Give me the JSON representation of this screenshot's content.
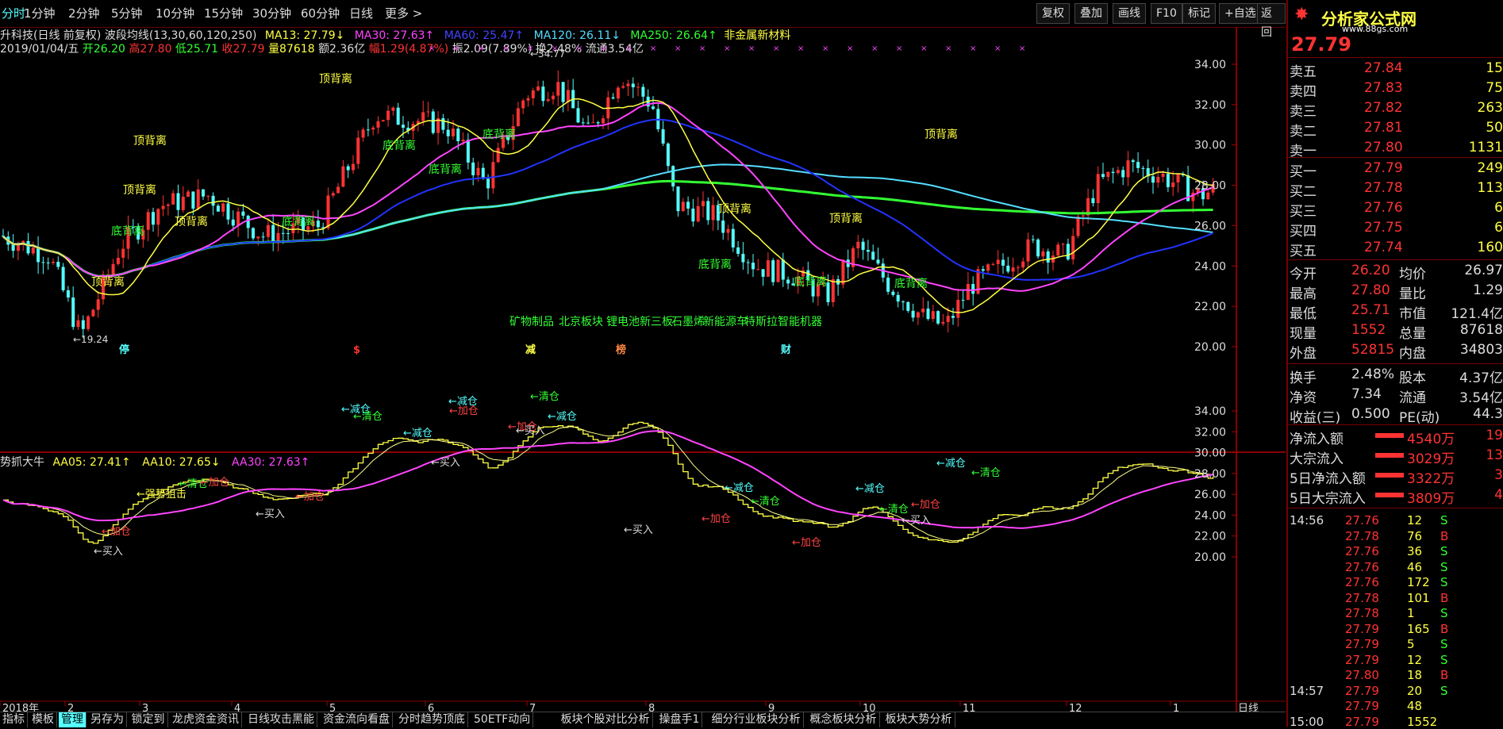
{
  "toolbar": {
    "periods": [
      "分时",
      "1分钟",
      "2分钟",
      "5分钟",
      "10分钟",
      "15分钟",
      "30分钟",
      "60分钟",
      "日线",
      "更多 >"
    ],
    "right_buttons": [
      "复权",
      "叠加",
      "画线",
      "F10",
      "标记",
      "+自选",
      "返回"
    ]
  },
  "info": {
    "stock_line": "升科技(日线 前复权) 波段均线(13,30,60,120,250)",
    "ma13": "MA13: 27.79↓",
    "ma30": "MA30: 27.63↑",
    "ma60": "MA60: 25.47↑",
    "ma120": "MA120: 26.11↓",
    "ma250": "MA250: 26.64↑",
    "sector": "非金属新材料",
    "date": "2019/01/04/五",
    "open": "开26.20",
    "high": "高27.80",
    "low": "低25.71",
    "close": "收27.79",
    "volume": "量87618",
    "amount": "额2.36亿",
    "change": "幅1.29(4.87%)",
    "amplitude": "振2.09(7.89%)",
    "turnover": "换2.48%",
    "float": "流通3.54亿"
  },
  "indicator": {
    "name": "势抓大牛",
    "aa05": "AA05: 27.41↑",
    "aa10": "AA10: 27.65↓",
    "aa30": "AA30: 27.63↑"
  },
  "colors": {
    "ma13": "#ffff44",
    "ma30": "#ff44ff",
    "ma60": "#2233ff",
    "ma120": "#55ddff",
    "ma250": "#33ff33",
    "up": "#ff3333",
    "down": "#55ffff"
  },
  "chart_data": {
    "type": "candlestick",
    "y_ticks_main": [
      "34.00",
      "32.00",
      "30.00",
      "28.00",
      "26.00",
      "24.00",
      "22.00",
      "20.00"
    ],
    "y_ticks_sub": [
      "34.00",
      "32.00",
      "30.00",
      "28.00",
      "26.00",
      "24.00",
      "22.00",
      "20.00"
    ],
    "x_labels": [
      "2018年",
      "2",
      "3",
      "4",
      "5",
      "6",
      "7",
      "8",
      "9",
      "10",
      "11",
      "12",
      "1"
    ],
    "period_label": "日线",
    "max_label": "34.77",
    "min_label": "19.24",
    "annotations_main": [
      "顶背离",
      "顶背离",
      "顶背离",
      "底背离",
      "顶背离",
      "底背离",
      "顶背离",
      "底背离",
      "底背离",
      "底背离",
      "顶背离",
      "底背离",
      "顶背离",
      "底背离",
      "顶背离",
      "底背离"
    ],
    "concepts": [
      "矿物制品",
      "北京板块",
      "锂电池",
      "新三板",
      "石墨烯",
      "新能源车",
      "特斯拉",
      "智能机器"
    ],
    "event_marks": [
      "停",
      "$",
      "减",
      "榜",
      "财"
    ],
    "annotations_sub": [
      "加仓",
      "买入",
      "强势狙击",
      "清仓",
      "加仓",
      "买入",
      "减仓",
      "清仓",
      "加仓",
      "减仓",
      "加仓",
      "买入",
      "减仓",
      "清仓",
      "减仓",
      "加仓",
      "买入",
      "买入",
      "加仓",
      "减仓",
      "清仓",
      "加仓",
      "减仓",
      "清仓",
      "加仓",
      "买入",
      "减仓",
      "清仓"
    ]
  },
  "quote": {
    "logo_main": "分析家公式网",
    "logo_url": "www.88gs.com",
    "last_price": "27.79",
    "asks": [
      {
        "label": "卖五",
        "price": "27.84",
        "vol": "15"
      },
      {
        "label": "卖四",
        "price": "27.83",
        "vol": "75"
      },
      {
        "label": "卖三",
        "price": "27.82",
        "vol": "263"
      },
      {
        "label": "卖二",
        "price": "27.81",
        "vol": "50"
      },
      {
        "label": "卖一",
        "price": "27.80",
        "vol": "1131"
      }
    ],
    "bids": [
      {
        "label": "买一",
        "price": "27.79",
        "vol": "249"
      },
      {
        "label": "买二",
        "price": "27.78",
        "vol": "113"
      },
      {
        "label": "买三",
        "price": "27.76",
        "vol": "6"
      },
      {
        "label": "买四",
        "price": "27.75",
        "vol": "6"
      },
      {
        "label": "买五",
        "price": "27.74",
        "vol": "160"
      }
    ],
    "stats": [
      {
        "k1": "今开",
        "v1": "26.20",
        "k2": "均价",
        "v2": "26.97"
      },
      {
        "k1": "最高",
        "v1": "27.80",
        "k2": "量比",
        "v2": "1.29"
      },
      {
        "k1": "最低",
        "v1": "25.71",
        "k2": "市值",
        "v2": "121.4亿"
      },
      {
        "k1": "现量",
        "v1": "1552",
        "k2": "总量",
        "v2": "87618"
      },
      {
        "k1": "外盘",
        "v1": "52815",
        "k2": "内盘",
        "v2": "34803"
      }
    ],
    "stats2": [
      {
        "k1": "换手",
        "v1": "2.48%",
        "k2": "股本",
        "v2": "4.37亿"
      },
      {
        "k1": "净资",
        "v1": "7.34",
        "k2": "流通",
        "v2": "3.54亿"
      },
      {
        "k1": "收益(三)",
        "v1": "0.500",
        "k2": "PE(动)",
        "v2": "44.3"
      }
    ],
    "flows": [
      {
        "label": "净流入额",
        "value": "4540万",
        "pct": "19"
      },
      {
        "label": "大宗流入",
        "value": "3029万",
        "pct": "13"
      },
      {
        "label": "5日净流入额",
        "value": "3322万",
        "pct": "3"
      },
      {
        "label": "5日大宗流入",
        "value": "3809万",
        "pct": "4"
      }
    ],
    "ticks": [
      {
        "time": "14:56",
        "price": "27.76",
        "vol": "12",
        "bs": "S"
      },
      {
        "time": "",
        "price": "27.78",
        "vol": "76",
        "bs": "B"
      },
      {
        "time": "",
        "price": "27.76",
        "vol": "36",
        "bs": "S"
      },
      {
        "time": "",
        "price": "27.76",
        "vol": "46",
        "bs": "S"
      },
      {
        "time": "",
        "price": "27.76",
        "vol": "172",
        "bs": "S"
      },
      {
        "time": "",
        "price": "27.78",
        "vol": "101",
        "bs": "B"
      },
      {
        "time": "",
        "price": "27.78",
        "vol": "1",
        "bs": "S"
      },
      {
        "time": "",
        "price": "27.79",
        "vol": "165",
        "bs": "B"
      },
      {
        "time": "",
        "price": "27.79",
        "vol": "5",
        "bs": "S"
      },
      {
        "time": "",
        "price": "27.79",
        "vol": "12",
        "bs": "S"
      },
      {
        "time": "",
        "price": "27.80",
        "vol": "18",
        "bs": "B"
      },
      {
        "time": "14:57",
        "price": "27.79",
        "vol": "20",
        "bs": "S"
      },
      {
        "time": "",
        "price": "27.79",
        "vol": "48",
        "bs": ""
      },
      {
        "time": "15:00",
        "price": "27.79",
        "vol": "1552",
        "bs": ""
      }
    ]
  },
  "tabs": [
    "指标",
    "模板",
    "管理",
    "另存为",
    "锁定到",
    "龙虎资金资讯",
    "日线攻击黑能",
    "资金流向看盘",
    "分时趋势顶底",
    "50ETF动向",
    "板块个股对比分析",
    "操盘手1",
    "细分行业板块分析",
    "概念板块分析",
    "板块大势分析"
  ]
}
